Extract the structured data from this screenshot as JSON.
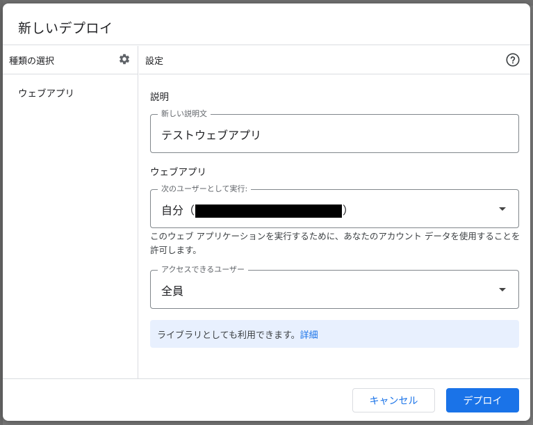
{
  "dialog": {
    "title": "新しいデプロイ"
  },
  "left_panel": {
    "header": "種類の選択",
    "header_icon": "gear-icon",
    "items": [
      {
        "label": "ウェブアプリ"
      }
    ]
  },
  "right_panel": {
    "header": "設定",
    "header_icon": "help-circle-icon",
    "description_section": "説明",
    "description_field": {
      "legend": "新しい説明文",
      "value": "テストウェブアプリ"
    },
    "webapp_section": "ウェブアプリ",
    "execute_as_field": {
      "legend": "次のユーザーとして実行:",
      "value_prefix": "自分（",
      "value_suffix": "）"
    },
    "execute_as_help": "このウェブ アプリケーションを実行するために、あなたのアカウント データを使用することを許可します。",
    "access_field": {
      "legend": "アクセスできるユーザー",
      "value": "全員"
    },
    "info": {
      "text": "ライブラリとしても利用できます。",
      "link": "詳細"
    }
  },
  "footer": {
    "cancel_label": "キャンセル",
    "deploy_label": "デプロイ"
  },
  "colors": {
    "accent": "#1a73e8",
    "info_bg": "#e8f0fe",
    "border": "#dadce0"
  }
}
